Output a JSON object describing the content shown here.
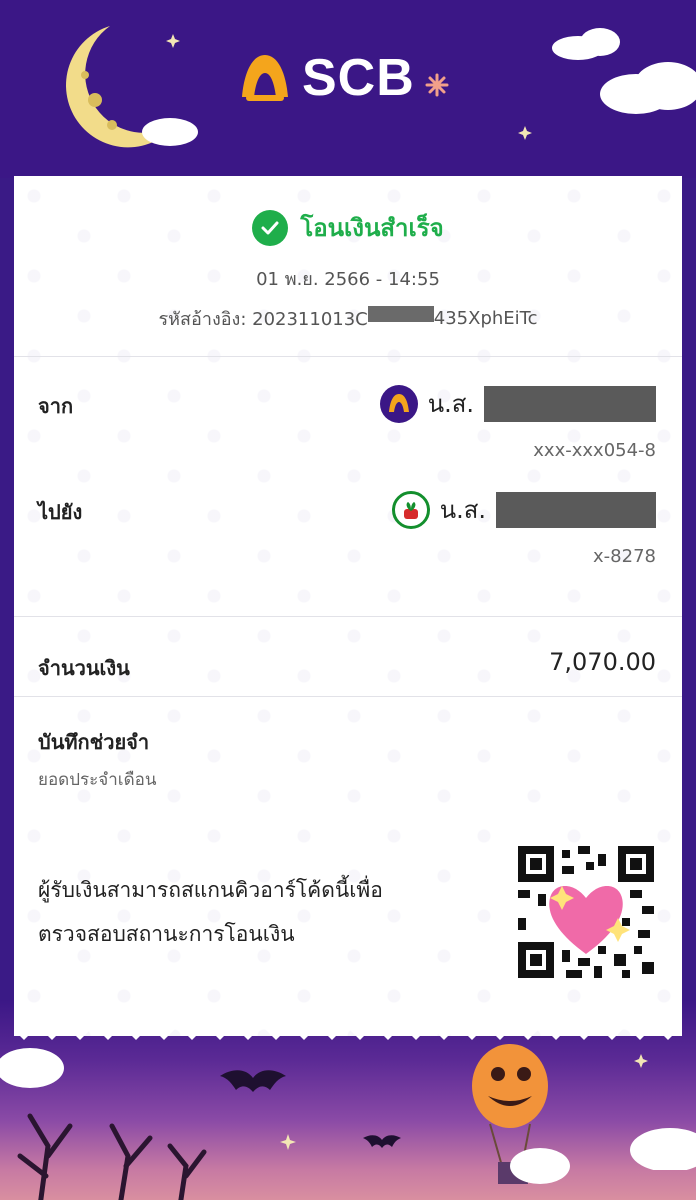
{
  "header": {
    "brand": "SCB"
  },
  "status": {
    "title": "โอนเงินสำเร็จ",
    "datetime": "01 พ.ย. 2566 - 14:55",
    "reference": "รหัสอ้างอิง: 202311013C",
    "reference_tail": "435XphEiTc"
  },
  "from": {
    "label": "จาก",
    "prefix": "น.ส.",
    "account": "xxx-xxx054-8"
  },
  "to": {
    "label": "ไปยัง",
    "prefix": "น.ส.",
    "account": "x-8278"
  },
  "amount": {
    "label": "จำนวนเงิน",
    "value": "7,070.00"
  },
  "memo": {
    "label": "บันทึกช่วยจำ",
    "value": "ยอดประจำเดือน"
  },
  "qr": {
    "line1": "ผู้รับเงินสามารถสแกนคิวอาร์โค้ดนี้เพื่อ",
    "line2": "ตรวจสอบสถานะการโอนเงิน"
  },
  "colors": {
    "brand_purple": "#3b1786",
    "success_green": "#1fae4b",
    "kbank_green": "#138f2d"
  }
}
